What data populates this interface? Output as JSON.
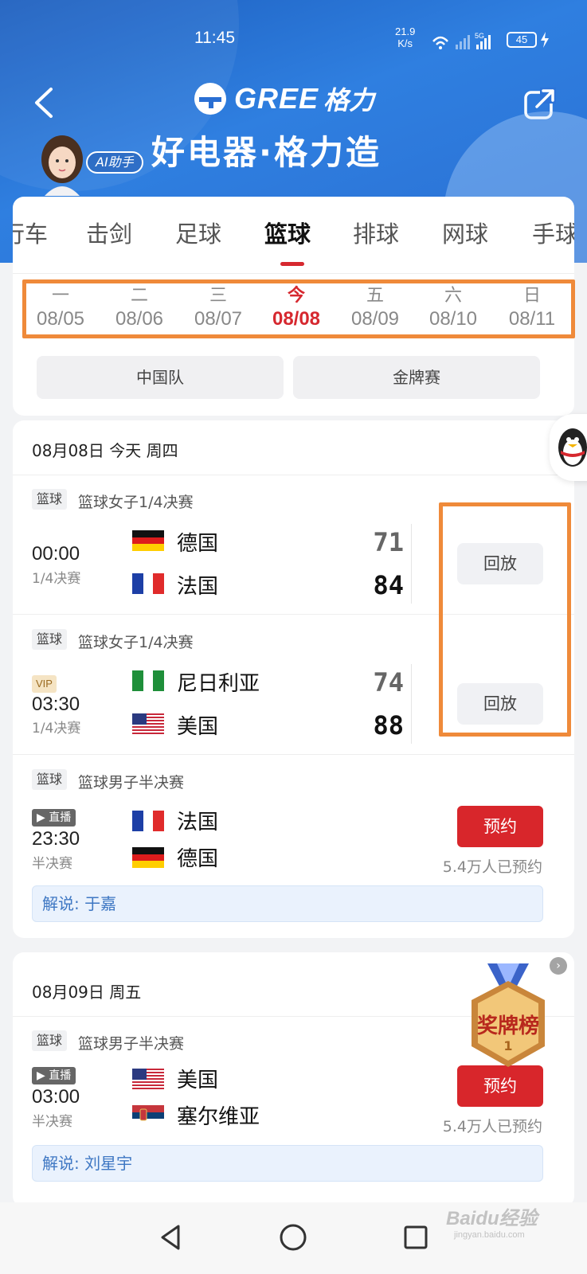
{
  "status": {
    "time": "11:45",
    "speed_value": "21.9",
    "speed_unit": "K/s",
    "network": "5G",
    "battery": "45"
  },
  "header": {
    "logo_text": "GREE",
    "logo_cn": "格力",
    "slogan": "好电器·格力造",
    "ai_label": "AI助手"
  },
  "sport_tabs": [
    {
      "label": "行车"
    },
    {
      "label": "击剑"
    },
    {
      "label": "足球"
    },
    {
      "label": "篮球"
    },
    {
      "label": "排球"
    },
    {
      "label": "网球"
    },
    {
      "label": "手球"
    }
  ],
  "active_sport_index": 3,
  "dates": [
    {
      "weekday": "一",
      "date": "08/05"
    },
    {
      "weekday": "二",
      "date": "08/06"
    },
    {
      "weekday": "三",
      "date": "08/07"
    },
    {
      "weekday": "今",
      "date": "08/08"
    },
    {
      "weekday": "五",
      "date": "08/09"
    },
    {
      "weekday": "六",
      "date": "08/10"
    },
    {
      "weekday": "日",
      "date": "08/11"
    }
  ],
  "filters": {
    "team": "中国队",
    "gold": "金牌赛"
  },
  "day1": {
    "heading": "08月08日 今天 周四",
    "matches": [
      {
        "tag": "篮球",
        "title": "篮球女子1/4决赛",
        "time": "00:00",
        "round": "1/4决赛",
        "team1": "德国",
        "team2": "法国",
        "score1": "71",
        "score2": "84",
        "action": "回放"
      },
      {
        "tag": "篮球",
        "title": "篮球女子1/4决赛",
        "badge": "VIP",
        "time": "03:30",
        "round": "1/4决赛",
        "team1": "尼日利亚",
        "team2": "美国",
        "score1": "74",
        "score2": "88",
        "action": "回放"
      },
      {
        "tag": "篮球",
        "title": "篮球男子半决赛",
        "live": "▶ 直播",
        "time": "23:30",
        "round": "半决赛",
        "team1": "法国",
        "team2": "德国",
        "action": "预约",
        "reserve_count": "5.4万人已预约",
        "commentary": "解说: 于嘉"
      }
    ]
  },
  "day2": {
    "heading": "08月09日 周五",
    "matches": [
      {
        "tag": "篮球",
        "title": "篮球男子半决赛",
        "live": "▶ 直播",
        "time": "03:00",
        "round": "半决赛",
        "team1": "美国",
        "team2": "塞尔维亚",
        "action": "预约",
        "reserve_count": "5.4万人已预约",
        "commentary": "解说: 刘星宇"
      }
    ]
  },
  "medal_label": "奖牌榜",
  "medal_rank": "1",
  "watermark": {
    "brand": "Baidu经验",
    "url": "jingyan.baidu.com"
  },
  "colors": {
    "accent_red": "#d6282f",
    "header_blue": "#2a6fd3",
    "highlight_orange": "#ef8a3a"
  }
}
